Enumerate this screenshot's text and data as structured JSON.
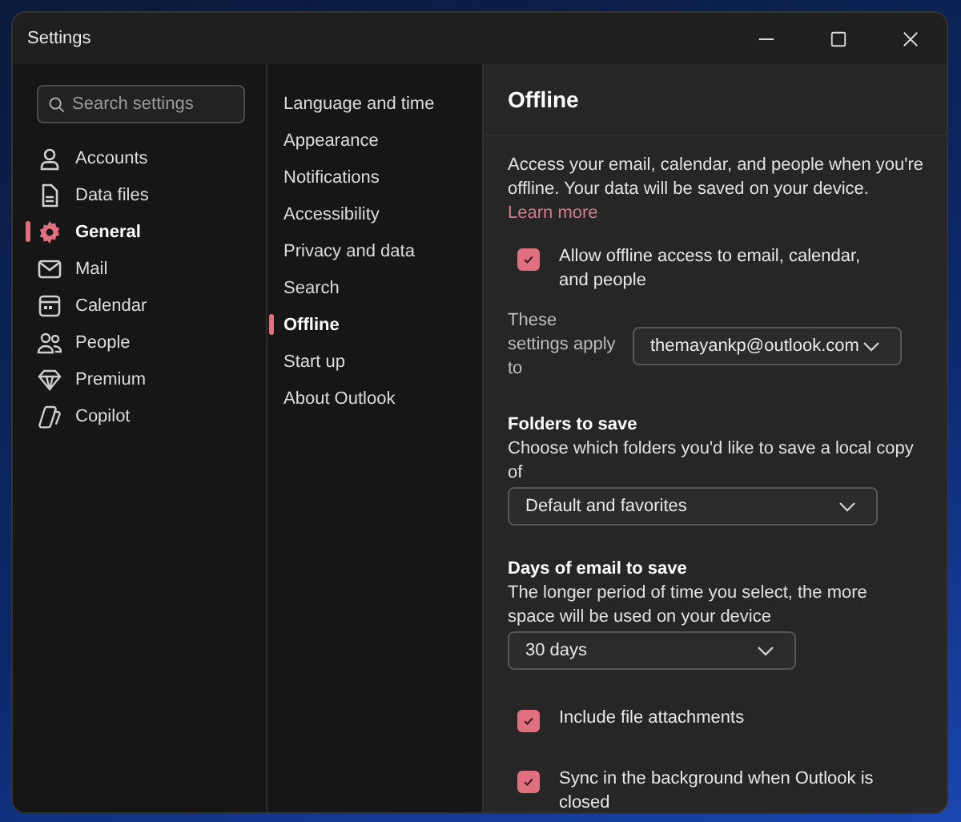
{
  "window": {
    "title": "Settings"
  },
  "search": {
    "placeholder": "Search settings"
  },
  "nav": [
    {
      "label": "Accounts",
      "selected": false
    },
    {
      "label": "Data files",
      "selected": false
    },
    {
      "label": "General",
      "selected": true
    },
    {
      "label": "Mail",
      "selected": false
    },
    {
      "label": "Calendar",
      "selected": false
    },
    {
      "label": "People",
      "selected": false
    },
    {
      "label": "Premium",
      "selected": false
    },
    {
      "label": "Copilot",
      "selected": false
    }
  ],
  "subnav": [
    {
      "label": "Language and time",
      "selected": false
    },
    {
      "label": "Appearance",
      "selected": false
    },
    {
      "label": "Notifications",
      "selected": false
    },
    {
      "label": "Accessibility",
      "selected": false
    },
    {
      "label": "Privacy and data",
      "selected": false
    },
    {
      "label": "Search",
      "selected": false
    },
    {
      "label": "Offline",
      "selected": true
    },
    {
      "label": "Start up",
      "selected": false
    },
    {
      "label": "About Outlook",
      "selected": false
    }
  ],
  "pane": {
    "title": "Offline",
    "description": {
      "text": "Access your email, calendar, and people when you're offline. Your data will be saved on your device.",
      "link": "Learn more"
    },
    "allow_offline": {
      "label": "Allow offline access to email, calendar, and people",
      "checked": true
    },
    "apply_to": {
      "label": "These settings apply to",
      "value": "themayankp@outlook.com"
    },
    "folders": {
      "heading": "Folders to save",
      "hint": "Choose which folders you'd like to save a local copy of",
      "value": "Default and favorites"
    },
    "days": {
      "heading": "Days of email to save",
      "hint": "The longer period of time you select, the more space will be used on your device",
      "value": "30 days"
    },
    "options": [
      {
        "label": "Include file attachments",
        "checked": true
      },
      {
        "label": "Sync in the background when Outlook is closed",
        "checked": true
      }
    ]
  }
}
